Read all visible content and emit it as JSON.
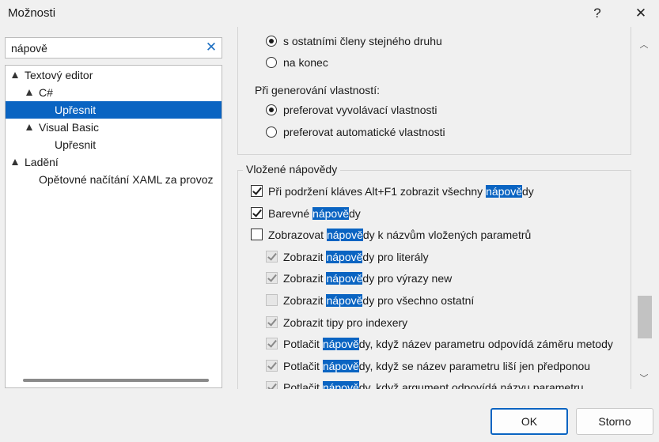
{
  "window": {
    "title": "Možnosti",
    "help_glyph": "?",
    "close_glyph": "✕"
  },
  "search": {
    "value": "nápově",
    "clear_glyph": "✕"
  },
  "tree": {
    "items": [
      {
        "label": "Textový editor",
        "level": 0,
        "expanded": true,
        "selected": false
      },
      {
        "label": "C#",
        "level": 1,
        "expanded": true,
        "selected": false
      },
      {
        "label": "Upřesnit",
        "level": 2,
        "expanded": null,
        "selected": true
      },
      {
        "label": "Visual Basic",
        "level": 1,
        "expanded": true,
        "selected": false
      },
      {
        "label": "Upřesnit",
        "level": 2,
        "expanded": null,
        "selected": false
      },
      {
        "label": "Ladění",
        "level": 0,
        "expanded": true,
        "selected": false
      },
      {
        "label": "Opětovné načítání XAML za provoz",
        "level": 1,
        "expanded": null,
        "selected": false
      }
    ]
  },
  "options": {
    "radio_group_1": [
      {
        "label": "s ostatními členy stejného druhu",
        "selected": true
      },
      {
        "label": "na konec",
        "selected": false
      }
    ],
    "properties_heading": "Při generování vlastností:",
    "radio_group_2": [
      {
        "label": "preferovat vyvolávací vlastnosti",
        "selected": true
      },
      {
        "label": "preferovat automatické vlastnosti",
        "selected": false
      }
    ],
    "inline_hints": {
      "title": "Vložené nápovědy",
      "items": [
        {
          "before": "Při podržení kláves Alt+F1 zobrazit všechny ",
          "match": "nápově",
          "after": "dy",
          "checked": true,
          "disabled": false,
          "indent": false
        },
        {
          "before": "Barevné ",
          "match": "nápově",
          "after": "dy",
          "checked": true,
          "disabled": false,
          "indent": false
        },
        {
          "before": "Zobrazovat ",
          "match": "nápově",
          "after": "dy k názvům vložených parametrů",
          "checked": false,
          "disabled": false,
          "indent": false
        },
        {
          "before": "Zobrazit ",
          "match": "nápově",
          "after": "dy pro literály",
          "checked": true,
          "disabled": true,
          "indent": true
        },
        {
          "before": "Zobrazit ",
          "match": "nápově",
          "after": "dy pro výrazy new",
          "checked": true,
          "disabled": true,
          "indent": true
        },
        {
          "before": "Zobrazit ",
          "match": "nápově",
          "after": "dy pro všechno ostatní",
          "checked": false,
          "disabled": true,
          "indent": true
        },
        {
          "before": "Zobrazit tipy pro indexery",
          "match": "",
          "after": "",
          "checked": true,
          "disabled": true,
          "indent": true
        },
        {
          "before": "Potlačit ",
          "match": "nápově",
          "after": "dy, když název parametru odpovídá záměru metody",
          "checked": true,
          "disabled": true,
          "indent": true
        },
        {
          "before": "Potlačit ",
          "match": "nápově",
          "after": "dy, když se název parametru liší jen předponou",
          "checked": true,
          "disabled": true,
          "indent": true
        },
        {
          "before": "Potlačit ",
          "match": "nápově",
          "after": "dy, když argument odpovídá názvu parametru",
          "checked": true,
          "disabled": true,
          "indent": true
        }
      ]
    }
  },
  "scrollbar": {
    "up_glyph": "︿",
    "down_glyph": "﹀",
    "position": 0.85
  },
  "buttons": {
    "ok": "OK",
    "cancel": "Storno"
  }
}
